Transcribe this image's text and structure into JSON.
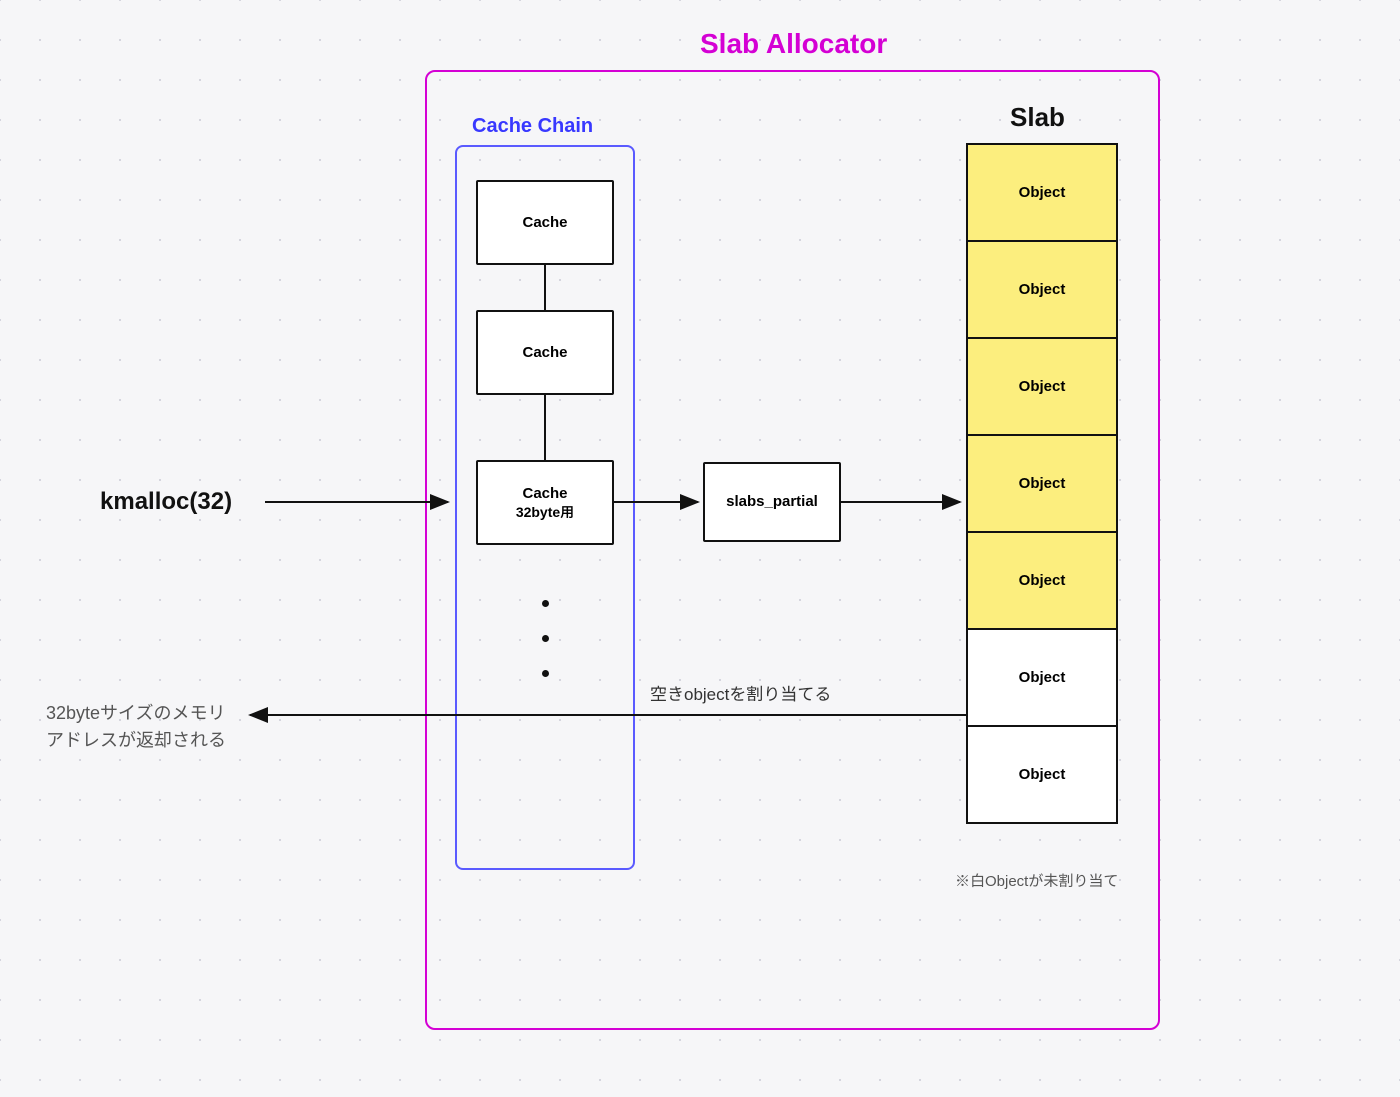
{
  "title": "Slab Allocator",
  "cache_chain_title": "Cache Chain",
  "slab_title": "Slab",
  "kmalloc_label": "kmalloc(32)",
  "cache_label_1": "Cache",
  "cache_label_2": "Cache",
  "cache_label_3a": "Cache",
  "cache_label_3b": "32byte用",
  "slabs_partial_label": "slabs_partial",
  "object_label": "Object",
  "assign_label": "空きobjectを割り当てる",
  "return_line1": "32byteサイズのメモリ",
  "return_line2": "アドレスが返却される",
  "footnote": "※白Objectが未割り当て",
  "chart_data": {
    "type": "diagram",
    "description": "Slab Allocator memory allocation flow",
    "nodes": [
      {
        "id": "kmalloc",
        "label": "kmalloc(32)",
        "type": "call"
      },
      {
        "id": "cache1",
        "label": "Cache",
        "type": "cache"
      },
      {
        "id": "cache2",
        "label": "Cache",
        "type": "cache"
      },
      {
        "id": "cache3",
        "label": "Cache 32byte用",
        "type": "cache"
      },
      {
        "id": "slabs_partial",
        "label": "slabs_partial",
        "type": "slablist"
      },
      {
        "id": "slab",
        "label": "Slab",
        "type": "slab",
        "objects": [
          {
            "state": "allocated"
          },
          {
            "state": "allocated"
          },
          {
            "state": "allocated"
          },
          {
            "state": "allocated"
          },
          {
            "state": "allocated"
          },
          {
            "state": "free"
          },
          {
            "state": "free"
          }
        ]
      }
    ],
    "edges": [
      {
        "from": "kmalloc",
        "to": "cache_chain"
      },
      {
        "from": "cache1",
        "to": "cache2"
      },
      {
        "from": "cache2",
        "to": "cache3"
      },
      {
        "from": "cache3",
        "to": "slabs_partial"
      },
      {
        "from": "slabs_partial",
        "to": "slab"
      },
      {
        "from": "slab",
        "to": "return",
        "label": "空きobjectを割り当てる"
      }
    ],
    "containers": [
      {
        "id": "slab_allocator",
        "label": "Slab Allocator",
        "contains": [
          "cache_chain",
          "slabs_partial",
          "slab"
        ]
      },
      {
        "id": "cache_chain",
        "label": "Cache Chain",
        "contains": [
          "cache1",
          "cache2",
          "cache3"
        ]
      }
    ],
    "annotations": [
      {
        "text": "32byteサイズのメモリアドレスが返却される",
        "target": "return"
      },
      {
        "text": "※白Objectが未割り当て",
        "target": "slab"
      }
    ]
  }
}
